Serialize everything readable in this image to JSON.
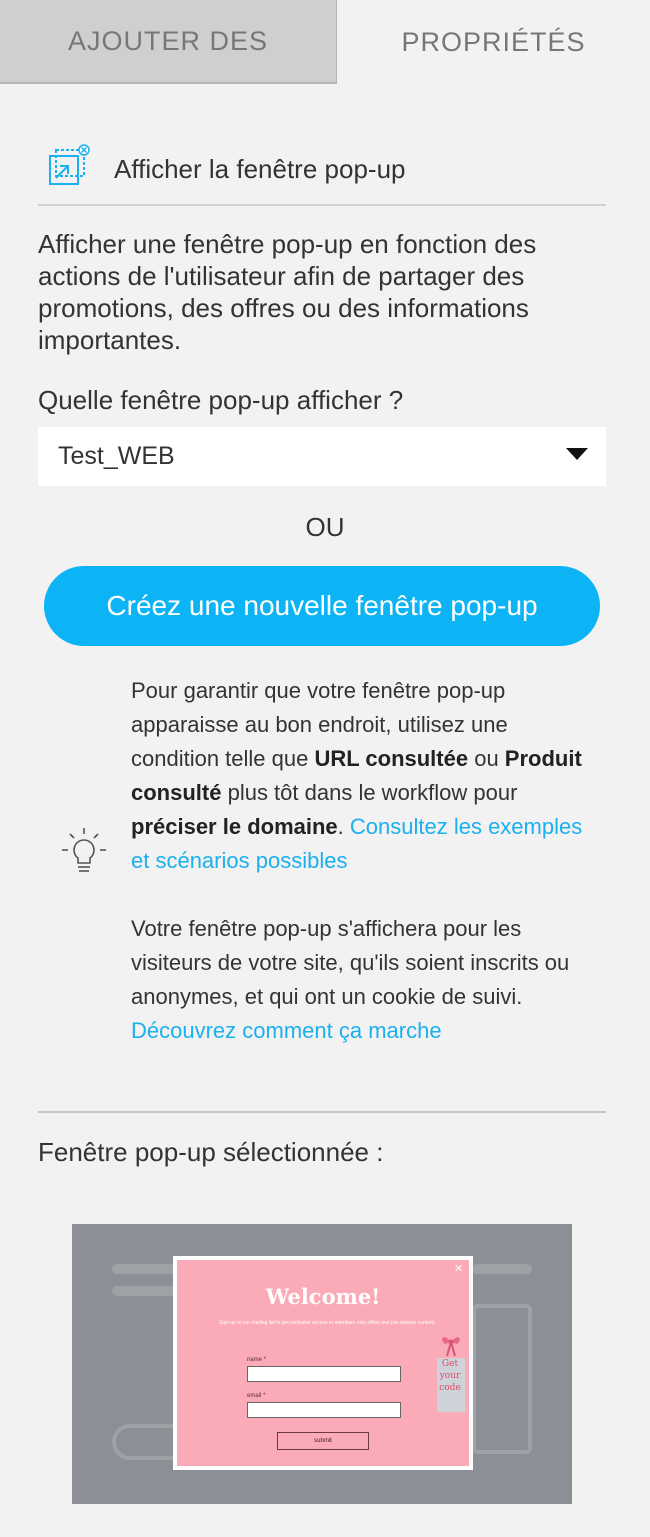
{
  "tabs": {
    "add": "AJOUTER DES",
    "properties": "PROPRIÉTÉS"
  },
  "header": {
    "icon": "popup-window-icon",
    "title": "Afficher la fenêtre pop-up"
  },
  "description": "Afficher une fenêtre pop-up en fonction des actions de l'utilisateur afin de partager des promotions, des offres ou des informations importantes.",
  "select": {
    "label": "Quelle fenêtre pop-up afficher ?",
    "value": "Test_WEB"
  },
  "or_text": "OU",
  "create_button": "Créez une nouvelle fenêtre pop-up",
  "tips": {
    "icon": "lightbulb-icon",
    "p1_a": "Pour garantir que votre fenêtre pop-up apparaisse au bon endroit, utilisez une condition telle que ",
    "p1_b": "URL consultée",
    "p1_c": " ou ",
    "p1_d": "Produit consulté",
    "p1_e": " plus tôt dans le workflow pour ",
    "p1_f": "préciser le domaine",
    "p1_g": ". ",
    "p1_link": "Consultez les exemples et scénarios possibles",
    "p2_a": "Votre fenêtre pop-up s'affichera pour les visiteurs de votre site, qu'ils soient inscrits ou anonymes, et qui ont un cookie de suivi. ",
    "p2_link": "Découvrez comment ça marche"
  },
  "selected_label": "Fenêtre pop-up sélectionnée :",
  "preview": {
    "close": "×",
    "title": "Welcome!",
    "subtitle": "Sign up to our mailing list to get exclusive access to members only offers and pre-release content.",
    "name_label": "name *",
    "email_label": "email *",
    "submit": "submit",
    "gift_text": "Get your code"
  },
  "colors": {
    "accent": "#0cb4f6",
    "link": "#1bb0ee",
    "popup_pink": "#fbaab7"
  }
}
